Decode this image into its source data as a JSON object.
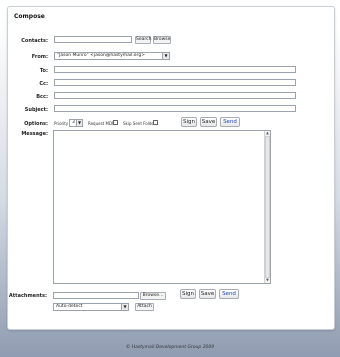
{
  "title": "Compose",
  "labels": {
    "contacts": "Contacts:",
    "from": "From:",
    "to": "To:",
    "cc": "Cc:",
    "bcc": "Bcc:",
    "subject": "Subject:",
    "options": "Options:",
    "message": "Message:",
    "attachments": "Attachments:"
  },
  "contacts": {
    "value": "",
    "search_label": "Search",
    "browse_label": "Browse"
  },
  "from": {
    "selected": "\"Jason Munro\"   <jason@hastymail.org>"
  },
  "to": {
    "value": ""
  },
  "cc": {
    "value": ""
  },
  "bcc": {
    "value": ""
  },
  "subject": {
    "value": ""
  },
  "options": {
    "priority_label": "Priority",
    "priority_value": "3",
    "mdn_label": "Request MDN",
    "skip_sent_label": "Skip Sent Folder"
  },
  "actions": {
    "sign": "Sign",
    "save": "Save",
    "send": "Send"
  },
  "message": {
    "value": ""
  },
  "attachments": {
    "browse_label": "Browse...",
    "encoding_selected": "Auto-detect",
    "attach_label": "Attach"
  },
  "footer": "© Hastymail Development Group 2009"
}
